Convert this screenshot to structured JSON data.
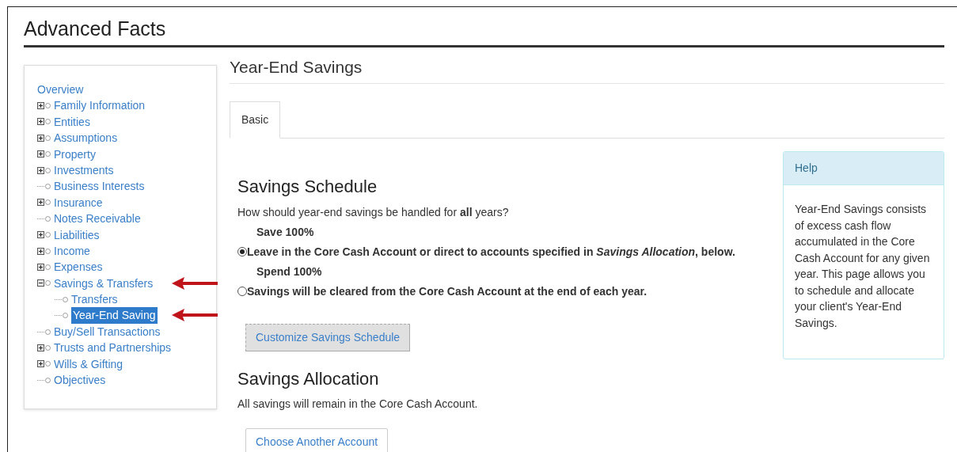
{
  "page_title": "Advanced Facts",
  "sidebar": {
    "overview": "Overview",
    "items": [
      {
        "label": "Family Information",
        "kind": "folder",
        "expanded": false,
        "selected": false,
        "marked": false
      },
      {
        "label": "Entities",
        "kind": "folder",
        "expanded": false,
        "selected": false,
        "marked": false
      },
      {
        "label": "Assumptions",
        "kind": "folder",
        "expanded": false,
        "selected": false,
        "marked": false
      },
      {
        "label": "Property",
        "kind": "folder",
        "expanded": false,
        "selected": false,
        "marked": false
      },
      {
        "label": "Investments",
        "kind": "folder",
        "expanded": false,
        "selected": false,
        "marked": false
      },
      {
        "label": "Business Interests",
        "kind": "leaf",
        "selected": false,
        "marked": false
      },
      {
        "label": "Insurance",
        "kind": "folder",
        "expanded": false,
        "selected": false,
        "marked": false
      },
      {
        "label": "Notes Receivable",
        "kind": "leaf",
        "selected": false,
        "marked": false
      },
      {
        "label": "Liabilities",
        "kind": "folder",
        "expanded": false,
        "selected": false,
        "marked": false
      },
      {
        "label": "Income",
        "kind": "folder",
        "expanded": false,
        "selected": false,
        "marked": false
      },
      {
        "label": "Expenses",
        "kind": "folder",
        "expanded": false,
        "selected": false,
        "marked": false
      },
      {
        "label": "Savings & Transfers",
        "kind": "folder",
        "expanded": true,
        "selected": false,
        "marked": true,
        "children": [
          {
            "label": "Transfers",
            "kind": "leaf",
            "selected": false,
            "marked": false
          },
          {
            "label": "Year-End Saving",
            "kind": "leaf",
            "selected": true,
            "marked": true
          }
        ]
      },
      {
        "label": "Buy/Sell Transactions",
        "kind": "leaf",
        "selected": false,
        "marked": false
      },
      {
        "label": "Trusts and Partnerships",
        "kind": "folder",
        "expanded": false,
        "selected": false,
        "marked": false
      },
      {
        "label": "Wills & Gifting",
        "kind": "folder",
        "expanded": false,
        "selected": false,
        "marked": false
      },
      {
        "label": "Objectives",
        "kind": "leaf",
        "selected": false,
        "marked": false
      }
    ]
  },
  "main": {
    "title": "Year-End Savings",
    "tabs": [
      {
        "label": "Basic",
        "selected": true
      }
    ],
    "schedule": {
      "heading": "Savings Schedule",
      "question": "How should year-end savings be handled for **all** years?",
      "options": [
        {
          "title": "Save 100%",
          "label": "Leave in the Core Cash Account or direct to accounts specified in *Savings Allocation*, below.",
          "selected": true
        },
        {
          "title": "Spend 100%",
          "label": "Savings will be cleared from the Core Cash Account at the end of each year.",
          "selected": false
        }
      ],
      "button": "Customize Savings Schedule"
    },
    "allocation": {
      "heading": "Savings Allocation",
      "text": "All savings will remain in the Core Cash Account.",
      "button": "Choose Another Account"
    }
  },
  "help": {
    "title": "Help",
    "text": "Year-End Savings consists of excess cash flow accumulated in the Core Cash Account for any given year. This page allows you to schedule and allocate your client's Year-End Savings."
  }
}
